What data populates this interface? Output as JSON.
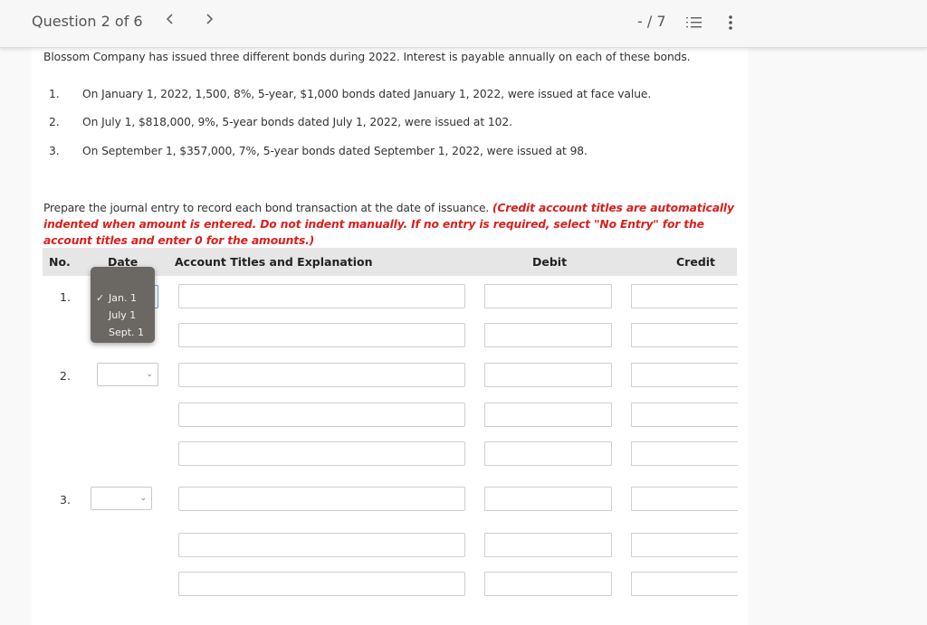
{
  "header": {
    "question_label": "Question 2 of 6",
    "prev_icon": "chevron-left-icon",
    "next_icon": "chevron-right-icon",
    "pager": "- / 7",
    "list_icon": "numbered-list-icon",
    "more_icon": "vertical-ellipsis-icon"
  },
  "problem": {
    "intro": "Blossom Company has issued three different bonds during 2022. Interest is payable annually on each of these bonds.",
    "items": [
      {
        "num": "1.",
        "text": "On January 1, 2022, 1,500, 8%, 5-year, $1,000 bonds dated January 1, 2022, were issued at face value."
      },
      {
        "num": "2.",
        "text": "On July 1, $818,000, 9%, 5-year bonds dated July 1, 2022, were issued at 102."
      },
      {
        "num": "3.",
        "text": "On September 1, $357,000, 7%, 5-year bonds dated September 1, 2022, were issued at 98."
      }
    ],
    "instruction": "Prepare the journal entry to record each bond transaction at the date of issuance.",
    "instruction_note": "(Credit account titles are automatically indented when amount is entered. Do not indent manually. If no entry is required, select \"No Entry\" for the account titles and enter 0 for the amounts.)",
    "note_color": "#d9201d"
  },
  "table": {
    "headers": {
      "no": "No.",
      "date": "Date",
      "account": "Account Titles and Explanation",
      "debit": "Debit",
      "credit": "Credit"
    },
    "entries": [
      {
        "no": "1.",
        "date": "",
        "lines": [
          {
            "account": "",
            "debit": "",
            "credit": ""
          },
          {
            "account": "",
            "debit": "",
            "credit": ""
          }
        ]
      },
      {
        "no": "2.",
        "date": "",
        "lines": [
          {
            "account": "",
            "debit": "",
            "credit": ""
          },
          {
            "account": "",
            "debit": "",
            "credit": ""
          },
          {
            "account": "",
            "debit": "",
            "credit": ""
          }
        ]
      },
      {
        "no": "3.",
        "date": "",
        "lines": [
          {
            "account": "",
            "debit": "",
            "credit": ""
          },
          {
            "account": "",
            "debit": "",
            "credit": ""
          },
          {
            "account": "",
            "debit": "",
            "credit": ""
          }
        ]
      }
    ]
  },
  "date_dropdown": {
    "open_for_entry": "1.",
    "options": [
      {
        "label": "Jan. 1",
        "checked": true
      },
      {
        "label": "July 1",
        "checked": false
      },
      {
        "label": "Sept. 1",
        "checked": false
      }
    ],
    "check_glyph": "✓"
  }
}
